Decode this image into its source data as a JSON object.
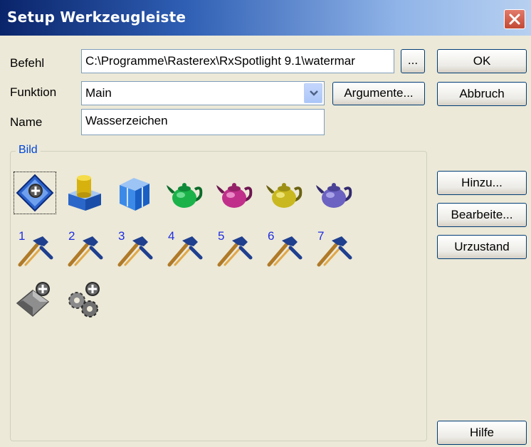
{
  "dialog": {
    "title": "Setup Werkzeugleiste"
  },
  "form": {
    "befehl_label": "Befehl",
    "befehl_value": "C:\\Programme\\Rasterex\\RxSpotlight 9.1\\watermar",
    "browse_label": "...",
    "funktion_label": "Funktion",
    "funktion_value": "Main",
    "argumente_label": "Argumente...",
    "name_label": "Name",
    "name_value": "Wasserzeichen"
  },
  "buttons": {
    "ok": "OK",
    "cancel": "Abbruch",
    "add": "Hinzu...",
    "edit": "Bearbeite...",
    "reset": "Urzustand",
    "help": "Hilfe"
  },
  "bild": {
    "title": "Bild",
    "row1_icons": [
      "blue-diamond-add-icon",
      "yellow-cylinder-box-icon",
      "blue-cube-icon",
      "teapot-green-icon",
      "teapot-magenta-icon",
      "teapot-yellow-icon",
      "teapot-purple-icon"
    ],
    "tool_numbers": [
      "1",
      "2",
      "3",
      "4",
      "5",
      "6",
      "7"
    ],
    "row3_icons": [
      "gray-diamond-add-icon",
      "gears-add-icon"
    ]
  },
  "colors": {
    "teapots": [
      "#1bb24a",
      "#c0308a",
      "#c9b820",
      "#6b62c2"
    ]
  }
}
